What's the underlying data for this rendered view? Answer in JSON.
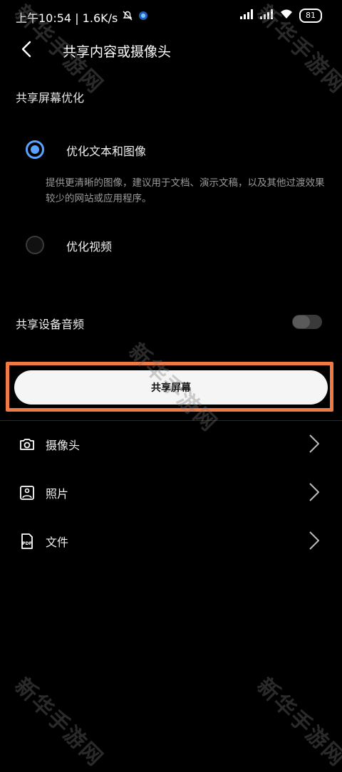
{
  "status_bar": {
    "time": "上午10:54 | 1.6K/s",
    "battery": "81"
  },
  "header": {
    "title": "共享内容或摄像头"
  },
  "optimization": {
    "section_label": "共享屏幕优化",
    "options": [
      {
        "label": "优化文本和图像",
        "selected": true
      },
      {
        "label": "优化视频",
        "selected": false
      }
    ],
    "description": "提供更清晰的图像，建议用于文档、演示文稿，以及其他过渡效果较少的网站或应用程序。"
  },
  "audio": {
    "label": "共享设备音频",
    "enabled": false
  },
  "share_button": {
    "label": "共享屏幕"
  },
  "list": [
    {
      "label": "摄像头",
      "icon": "camera-icon"
    },
    {
      "label": "照片",
      "icon": "photo-icon"
    },
    {
      "label": "文件",
      "icon": "pdf-file-icon"
    }
  ],
  "watermark": {
    "text": "新华手游网"
  },
  "colors": {
    "background": "#000000",
    "accent": "#5aa2ff",
    "highlight_border": "#f07a45",
    "button_bg": "#f5f5f5"
  }
}
